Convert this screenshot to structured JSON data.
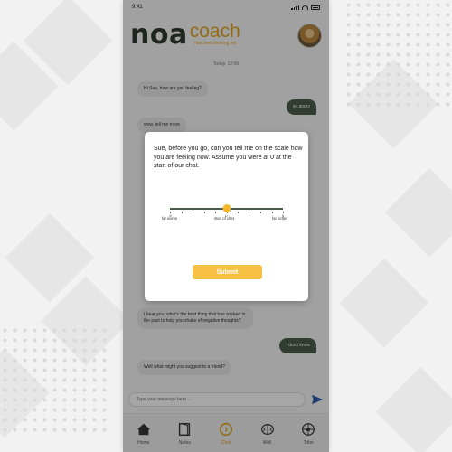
{
  "status": {
    "time": "9:41"
  },
  "brand": {
    "name": "noa",
    "suffix": "coach",
    "tagline": "Your best thinking yet"
  },
  "chat": {
    "date": "Today, 12:06",
    "messages": [
      {
        "from": "coach",
        "text": "Hi Sue, how are you feeling?"
      },
      {
        "from": "user",
        "text": "so angry"
      },
      {
        "from": "coach",
        "text": "wow, tell me more"
      },
      {
        "from": "coach",
        "text": "I hear you, what's the best thing that has worked in the past to help you shake of negative thoughts?"
      },
      {
        "from": "user",
        "text": "I don't know"
      },
      {
        "from": "coach",
        "text": "Well what might you suggest to a friend?"
      }
    ]
  },
  "composer": {
    "placeholder": "Type your message here ..."
  },
  "tabs": [
    {
      "label": "Home",
      "icon": "home-icon",
      "active": false
    },
    {
      "label": "Notes",
      "icon": "notes-icon",
      "active": false
    },
    {
      "label": "Chat",
      "icon": "chat-icon",
      "active": true
    },
    {
      "label": "Well",
      "icon": "brain-icon",
      "active": false
    },
    {
      "label": "Tribe",
      "icon": "tribe-icon",
      "active": false
    }
  ],
  "modal": {
    "prompt": "Sue, before you go, can you tell me on the scale how you are feeling now. Assume you were at 0 at the start of our chat.",
    "scale": {
      "ticks": [
        "-5",
        "-4",
        "-3",
        "-2",
        "-1",
        "0",
        "1",
        "2",
        "3",
        "4",
        "5"
      ],
      "value": 0,
      "low_label": "far worse",
      "mid_label": "start of chat",
      "high_label": "far better"
    },
    "submit_label": "Submit"
  },
  "colors": {
    "brand_dark": "#2f3b30",
    "brand_gold": "#e0a520",
    "button": "#f5c044",
    "user_bubble": "#4d5e4e"
  }
}
